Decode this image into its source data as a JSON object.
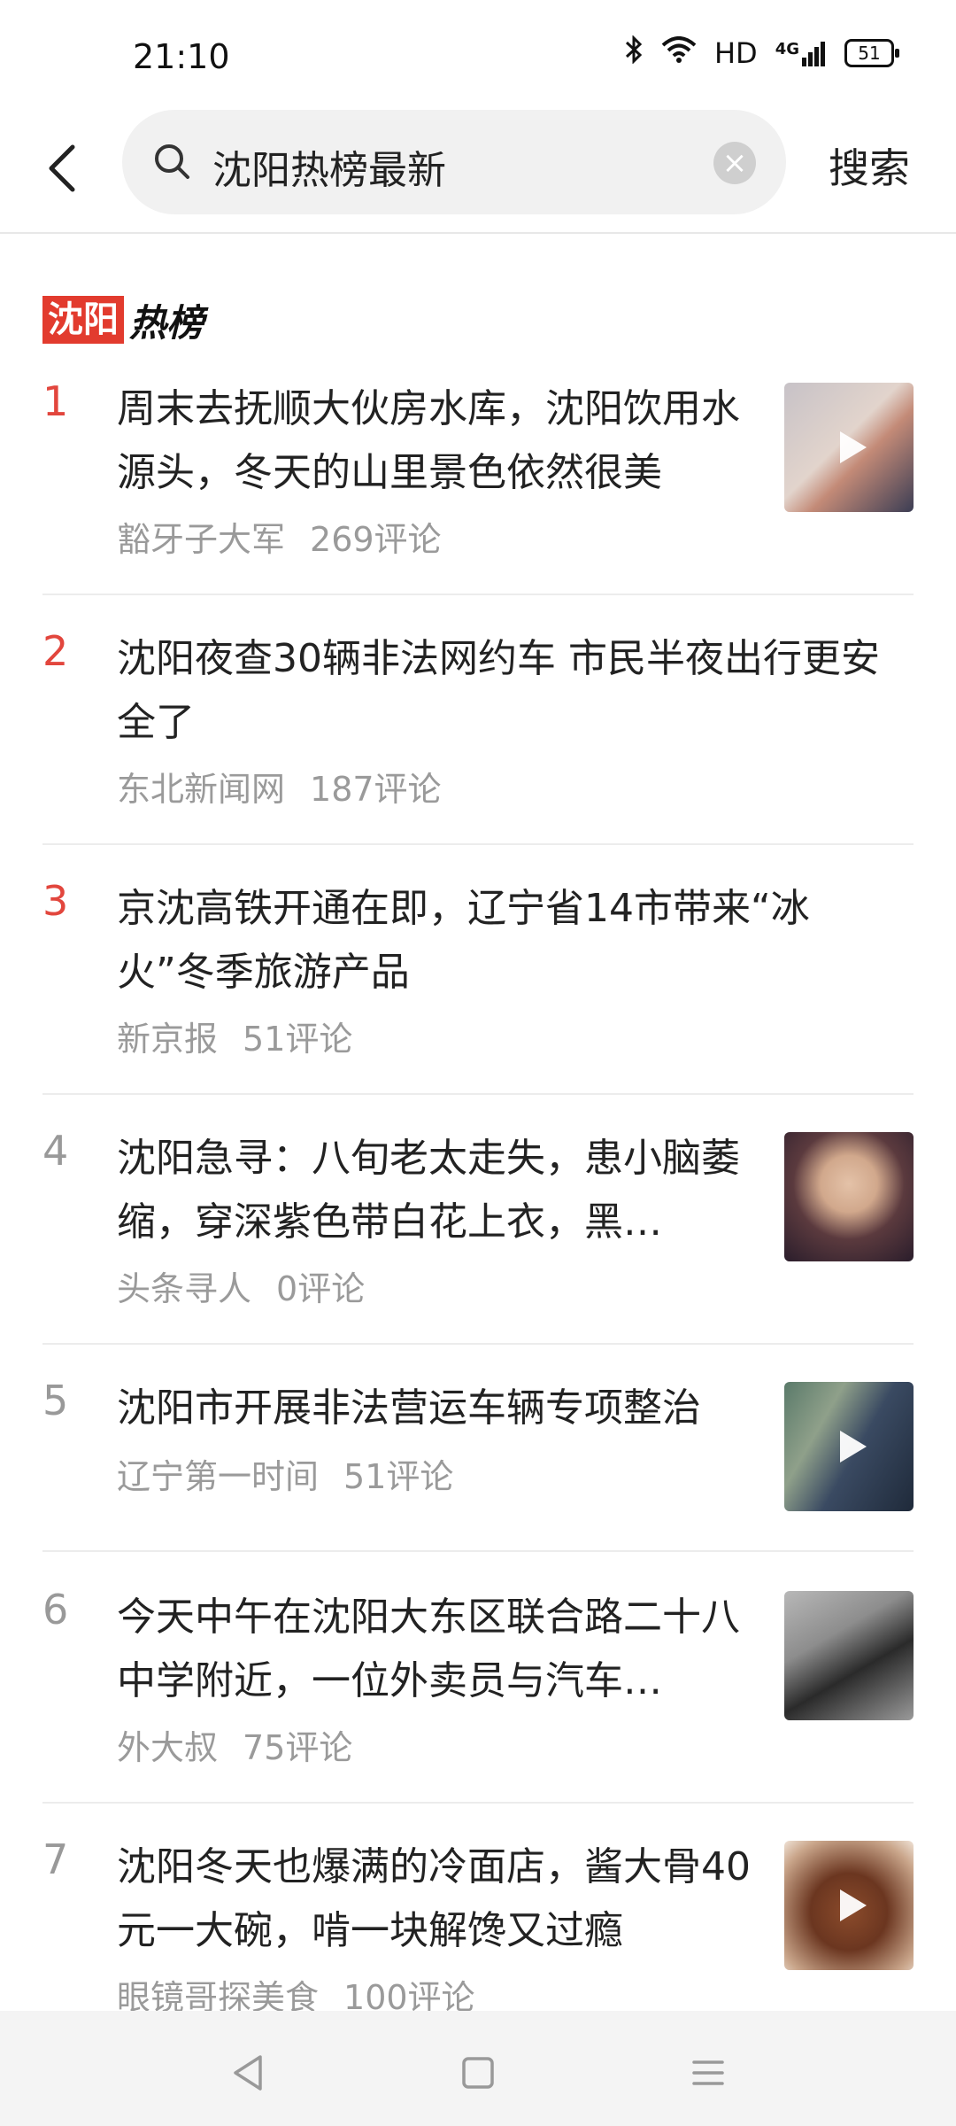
{
  "status": {
    "time": "21:10",
    "network": "HD",
    "signal": "4G",
    "battery": "51"
  },
  "search": {
    "query": "沈阳热榜最新",
    "button": "搜索"
  },
  "logo": {
    "part1": "沈阳",
    "part2": "热榜"
  },
  "items": [
    {
      "rank": "1",
      "title": "周末去抚顺大伙房水库，沈阳饮用水源头，冬天的山里景色依然很美",
      "source": "豁牙子大军",
      "comments": "269评论",
      "thumb": "video"
    },
    {
      "rank": "2",
      "title": "沈阳夜查30辆非法网约车 市民半夜出行更安全了",
      "source": "东北新闻网",
      "comments": "187评论"
    },
    {
      "rank": "3",
      "title": "京沈高铁开通在即，辽宁省14市带来“冰火”冬季旅游产品",
      "source": "新京报",
      "comments": "51评论"
    },
    {
      "rank": "4",
      "title": "沈阳急寻：八旬老太走失，患小脑萎缩，穿深紫色带白花上衣，黑…",
      "source": "头条寻人",
      "comments": "0评论",
      "thumb": "photo"
    },
    {
      "rank": "5",
      "title": "沈阳市开展非法营运车辆专项整治",
      "source": "辽宁第一时间",
      "comments": "51评论",
      "thumb": "video"
    },
    {
      "rank": "6",
      "title": "今天中午在沈阳大东区联合路二十八中学附近，一位外卖员与汽车…",
      "source": "外大叔",
      "comments": "75评论",
      "thumb": "photo"
    },
    {
      "rank": "7",
      "title": "沈阳冬天也爆满的冷面店，酱大骨40元一大碗，啃一块解馋又过瘾",
      "source": "眼镜哥探美食",
      "comments": "100评论",
      "thumb": "video"
    }
  ],
  "colors": {
    "accent": "#e2463d",
    "meta": "#9a9a9a"
  }
}
